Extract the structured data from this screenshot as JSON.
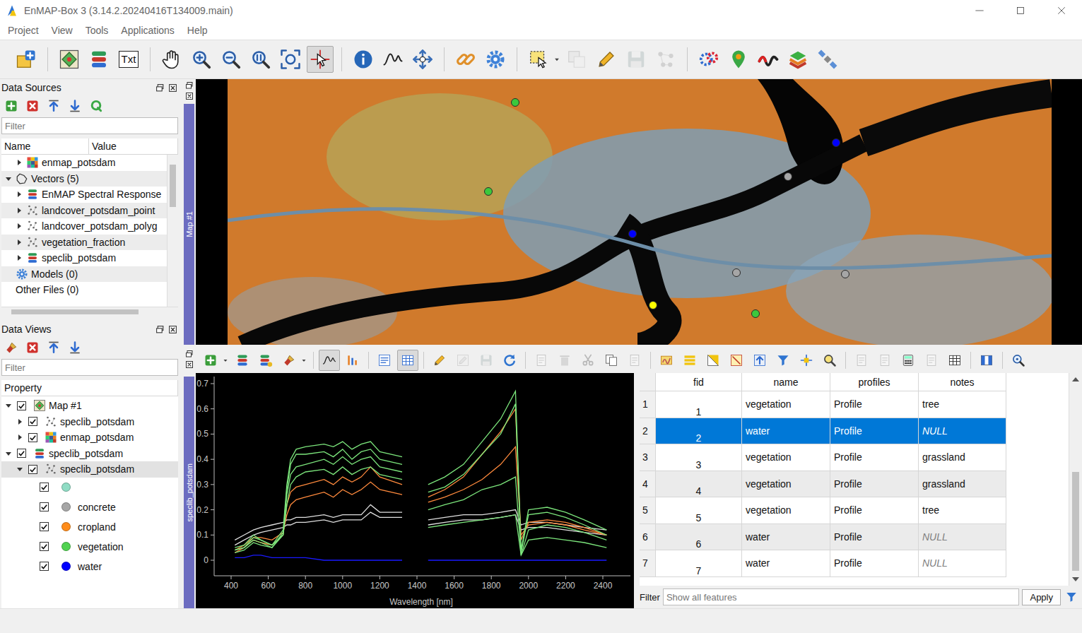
{
  "window": {
    "title": "EnMAP-Box 3 (3.14.2.20240416T134009.main)"
  },
  "menu": [
    {
      "label": "Project"
    },
    {
      "label": "View"
    },
    {
      "label": "Tools"
    },
    {
      "label": "Applications"
    },
    {
      "label": "Help"
    }
  ],
  "toolbar": {
    "txt_label": "Txt",
    "tools": [
      {
        "active": false,
        "disabled": false
      },
      {
        "active": false,
        "disabled": false
      },
      {
        "active": false,
        "disabled": false
      },
      {
        "active": false,
        "disabled": false
      },
      {
        "active": false,
        "disabled": false
      },
      {
        "active": false,
        "disabled": false
      },
      {
        "active": false,
        "disabled": false
      },
      {
        "active": false,
        "disabled": false
      },
      {
        "active": false,
        "disabled": false
      },
      {
        "active": true,
        "disabled": false
      },
      {
        "active": false,
        "disabled": false
      },
      {
        "active": false,
        "disabled": false
      },
      {
        "active": false,
        "disabled": false
      },
      {
        "active": false,
        "disabled": false
      },
      {
        "active": false,
        "disabled": false
      },
      {
        "active": false,
        "disabled": false
      },
      {
        "active": false,
        "disabled": true
      },
      {
        "active": false,
        "disabled": false
      },
      {
        "active": false,
        "disabled": true
      },
      {
        "active": false,
        "disabled": true
      },
      {
        "active": false,
        "disabled": false
      },
      {
        "active": false,
        "disabled": false
      },
      {
        "active": false,
        "disabled": false
      },
      {
        "active": false,
        "disabled": false
      },
      {
        "active": false,
        "disabled": false
      }
    ]
  },
  "data_sources": {
    "title": "Data Sources",
    "filter_placeholder": "Filter",
    "columns": [
      "Name",
      "Value"
    ],
    "items": [
      {
        "label": "enmap_potsdam",
        "level": 1,
        "kind": "raster",
        "expandable": true,
        "expanded": false
      },
      {
        "label": "Vectors (5)",
        "level": 0,
        "kind": "vectors",
        "expandable": true,
        "expanded": true
      },
      {
        "label": "EnMAP Spectral Response",
        "level": 1,
        "kind": "spectral-library",
        "expandable": true,
        "expanded": false
      },
      {
        "label": "landcover_potsdam_point",
        "level": 1,
        "kind": "points",
        "expandable": true,
        "expanded": false
      },
      {
        "label": "landcover_potsdam_polyg",
        "level": 1,
        "kind": "points",
        "expandable": true,
        "expanded": false
      },
      {
        "label": "vegetation_fraction",
        "level": 1,
        "kind": "points",
        "expandable": true,
        "expanded": false
      },
      {
        "label": "speclib_potsdam",
        "level": 1,
        "kind": "spectral-library",
        "expandable": true,
        "expanded": false
      },
      {
        "label": "Models (0)",
        "level": 0,
        "kind": "gear",
        "expandable": false,
        "expanded": false
      },
      {
        "label": "Other Files (0)",
        "level": 0,
        "kind": "none",
        "expandable": false,
        "expanded": false
      }
    ]
  },
  "data_views": {
    "title": "Data Views",
    "filter_placeholder": "Filter",
    "columns": [
      "Property"
    ],
    "items": [
      {
        "label": "Map #1",
        "level": 0,
        "kind": "map-view",
        "expandable": true,
        "expanded": true,
        "checked": true,
        "selected": false
      },
      {
        "label": "speclib_potsdam",
        "level": 1,
        "kind": "points",
        "expandable": true,
        "expanded": false,
        "checked": true,
        "selected": false
      },
      {
        "label": "enmap_potsdam",
        "level": 1,
        "kind": "raster",
        "expandable": true,
        "expanded": false,
        "checked": true,
        "selected": false
      },
      {
        "label": "speclib_potsdam",
        "level": 0,
        "kind": "spectral-library",
        "expandable": true,
        "expanded": true,
        "checked": true,
        "selected": false
      },
      {
        "label": "speclib_potsdam",
        "level": 1,
        "kind": "points",
        "expandable": true,
        "expanded": true,
        "checked": true,
        "selected": true
      },
      {
        "label": "",
        "level": 2,
        "kind": "legend",
        "color": "#8fdcc4",
        "expandable": false,
        "expanded": false,
        "checked": true,
        "selected": false
      },
      {
        "label": "concrete",
        "level": 2,
        "kind": "legend",
        "color": "#a6a6a6",
        "expandable": false,
        "expanded": false,
        "checked": true,
        "selected": false
      },
      {
        "label": "cropland",
        "level": 2,
        "kind": "legend",
        "color": "#ff8c1a",
        "expandable": false,
        "expanded": false,
        "checked": true,
        "selected": false
      },
      {
        "label": "vegetation",
        "level": 2,
        "kind": "legend",
        "color": "#50d250",
        "expandable": false,
        "expanded": false,
        "checked": true,
        "selected": false
      },
      {
        "label": "water",
        "level": 2,
        "kind": "legend",
        "color": "#0000ff",
        "expandable": false,
        "expanded": false,
        "checked": true,
        "selected": false
      }
    ]
  },
  "map": {
    "label": "Map #1",
    "points": [
      {
        "color": "#3cc83c"
      },
      {
        "color": "#3cc83c"
      },
      {
        "color": "#0000ff"
      },
      {
        "color": "#a6a6a6"
      },
      {
        "color": "#0000ff"
      },
      {
        "color": "#a6a6a6"
      },
      {
        "color": "#a6a6a6"
      },
      {
        "color": "#ffff00"
      },
      {
        "color": "#3cc83c"
      }
    ]
  },
  "speclib": {
    "dock_label": "speclib_potsdam",
    "tools": [
      {
        "active": false,
        "disabled": false
      },
      {
        "active": false,
        "disabled": false
      },
      {
        "active": false,
        "disabled": false
      },
      {
        "active": false,
        "disabled": false
      },
      {
        "active": true,
        "disabled": false
      },
      {
        "active": false,
        "disabled": false
      },
      {
        "active": false,
        "disabled": false
      },
      {
        "active": true,
        "disabled": false
      },
      {
        "active": false,
        "disabled": false
      },
      {
        "active": false,
        "disabled": true
      },
      {
        "active": false,
        "disabled": true
      },
      {
        "active": false,
        "disabled": false
      },
      {
        "active": false,
        "disabled": true
      },
      {
        "active": false,
        "disabled": true
      },
      {
        "active": false,
        "disabled": true
      },
      {
        "active": false,
        "disabled": false
      },
      {
        "active": false,
        "disabled": true
      },
      {
        "active": false,
        "disabled": false
      },
      {
        "active": false,
        "disabled": false
      },
      {
        "active": false,
        "disabled": false
      },
      {
        "active": false,
        "disabled": false
      },
      {
        "active": false,
        "disabled": false
      },
      {
        "active": false,
        "disabled": false
      },
      {
        "active": false,
        "disabled": false
      },
      {
        "active": false,
        "disabled": false
      },
      {
        "active": false,
        "disabled": true
      },
      {
        "active": false,
        "disabled": true
      },
      {
        "active": false,
        "disabled": false
      },
      {
        "active": false,
        "disabled": true
      },
      {
        "active": false,
        "disabled": false
      },
      {
        "active": false,
        "disabled": false
      },
      {
        "active": false,
        "disabled": false
      }
    ],
    "chart": {
      "y_ticks": [
        {
          "label": "0.7",
          "value": 0.7
        },
        {
          "label": "0.6",
          "value": 0.6
        },
        {
          "label": "0.5",
          "value": 0.5
        },
        {
          "label": "0.4",
          "value": 0.4
        },
        {
          "label": "0.3",
          "value": 0.3
        },
        {
          "label": "0.2",
          "value": 0.2
        },
        {
          "label": "0.1",
          "value": 0.1
        },
        {
          "label": "0",
          "value": 0
        }
      ],
      "x_ticks": [
        {
          "label": "400",
          "value": 400
        },
        {
          "label": "600",
          "value": 600
        },
        {
          "label": "800",
          "value": 800
        },
        {
          "label": "1000",
          "value": 1000
        },
        {
          "label": "1200",
          "value": 1200
        },
        {
          "label": "1400",
          "value": 1400
        },
        {
          "label": "1600",
          "value": 1600
        },
        {
          "label": "1800",
          "value": 1800
        },
        {
          "label": "2000",
          "value": 2000
        },
        {
          "label": "2200",
          "value": 2200
        },
        {
          "label": "2400",
          "value": 2400
        }
      ],
      "x_label": "Wavelength [nm]",
      "wavelengths": [
        420,
        470,
        520,
        560,
        620,
        680,
        700,
        720,
        750,
        800,
        900,
        950,
        1000,
        1050,
        1100,
        1150,
        1200,
        1320,
        1460,
        1550,
        1650,
        1750,
        1850,
        1930,
        1960,
        2000,
        2100,
        2200,
        2300,
        2420
      ],
      "series": [
        {
          "color": "#e0e0e0",
          "values": [
            0.08,
            0.1,
            0.12,
            0.13,
            0.14,
            0.15,
            0.16,
            0.16,
            0.17,
            0.17,
            0.18,
            0.17,
            0.18,
            0.18,
            0.18,
            0.22,
            0.19,
            0.19,
            0.16,
            0.17,
            0.18,
            0.18,
            0.19,
            0.2,
            0.14,
            0.15,
            0.15,
            0.14,
            0.13,
            0.12
          ]
        },
        {
          "color": "#e0e0e0",
          "values": [
            0.06,
            0.08,
            0.1,
            0.11,
            0.12,
            0.13,
            0.14,
            0.14,
            0.15,
            0.15,
            0.16,
            0.15,
            0.16,
            0.16,
            0.16,
            0.19,
            0.17,
            0.17,
            0.14,
            0.15,
            0.16,
            0.16,
            0.17,
            0.18,
            0.12,
            0.13,
            0.13,
            0.12,
            0.11,
            0.1
          ]
        },
        {
          "color": "#ff8a3d",
          "values": [
            0.03,
            0.05,
            0.08,
            0.07,
            0.06,
            0.1,
            0.22,
            0.27,
            0.29,
            0.3,
            0.32,
            0.3,
            0.33,
            0.31,
            0.33,
            0.37,
            0.33,
            0.3,
            0.25,
            0.28,
            0.33,
            0.42,
            0.51,
            0.6,
            0.08,
            0.15,
            0.16,
            0.15,
            0.13,
            0.1
          ]
        },
        {
          "color": "#ff8a3d",
          "values": [
            0.04,
            0.06,
            0.09,
            0.09,
            0.08,
            0.11,
            0.18,
            0.22,
            0.24,
            0.25,
            0.27,
            0.25,
            0.28,
            0.26,
            0.28,
            0.31,
            0.28,
            0.26,
            0.23,
            0.25,
            0.28,
            0.32,
            0.38,
            0.45,
            0.1,
            0.14,
            0.15,
            0.14,
            0.12,
            0.1
          ]
        },
        {
          "color": "#7ce67c",
          "values": [
            0.04,
            0.05,
            0.09,
            0.08,
            0.06,
            0.12,
            0.3,
            0.4,
            0.44,
            0.45,
            0.46,
            0.45,
            0.47,
            0.44,
            0.46,
            0.47,
            0.43,
            0.41,
            0.3,
            0.33,
            0.38,
            0.47,
            0.56,
            0.67,
            0.04,
            0.2,
            0.21,
            0.19,
            0.16,
            0.12
          ]
        },
        {
          "color": "#7ce67c",
          "values": [
            0.03,
            0.04,
            0.07,
            0.06,
            0.05,
            0.1,
            0.28,
            0.38,
            0.42,
            0.42,
            0.43,
            0.41,
            0.44,
            0.4,
            0.43,
            0.44,
            0.4,
            0.38,
            0.27,
            0.29,
            0.34,
            0.42,
            0.5,
            0.62,
            0.03,
            0.18,
            0.19,
            0.17,
            0.14,
            0.1
          ]
        },
        {
          "color": "#7ce67c",
          "values": [
            0.04,
            0.05,
            0.08,
            0.07,
            0.05,
            0.11,
            0.26,
            0.34,
            0.37,
            0.38,
            0.4,
            0.38,
            0.41,
            0.38,
            0.4,
            0.41,
            0.37,
            0.35,
            0.2,
            0.22,
            0.24,
            0.28,
            0.3,
            0.33,
            0.02,
            0.12,
            0.14,
            0.13,
            0.11,
            0.08
          ]
        },
        {
          "color": "#7ce67c",
          "values": [
            0.05,
            0.06,
            0.1,
            0.08,
            0.06,
            0.1,
            0.22,
            0.3,
            0.33,
            0.35,
            0.36,
            0.34,
            0.37,
            0.34,
            0.36,
            0.37,
            0.34,
            0.32,
            0.13,
            0.14,
            0.15,
            0.16,
            0.17,
            0.18,
            0.02,
            0.08,
            0.09,
            0.08,
            0.07,
            0.05
          ]
        },
        {
          "color": "#1a1aff",
          "values": [
            0.01,
            0.01,
            0.02,
            0.02,
            0.01,
            0.01,
            0.01,
            0.01,
            0.01,
            0.01,
            0,
            0,
            0,
            0,
            0,
            0,
            0,
            0,
            0,
            0,
            0,
            0,
            0,
            0,
            0,
            0,
            0,
            0,
            0,
            0
          ]
        }
      ]
    },
    "table": {
      "columns": [
        "fid",
        "name",
        "profiles",
        "notes"
      ],
      "rows": [
        {
          "num": "1",
          "fid": "1",
          "name": "vegetation",
          "profiles": "Profile",
          "notes": "tree",
          "notes_null": false,
          "selected": false
        },
        {
          "num": "2",
          "fid": "2",
          "name": "water",
          "profiles": "Profile",
          "notes": "NULL",
          "notes_null": true,
          "selected": true
        },
        {
          "num": "3",
          "fid": "3",
          "name": "vegetation",
          "profiles": "Profile",
          "notes": "grassland",
          "notes_null": false,
          "selected": false
        },
        {
          "num": "4",
          "fid": "4",
          "name": "vegetation",
          "profiles": "Profile",
          "notes": "grassland",
          "notes_null": false,
          "selected": false
        },
        {
          "num": "5",
          "fid": "5",
          "name": "vegetation",
          "profiles": "Profile",
          "notes": "tree",
          "notes_null": false,
          "selected": false
        },
        {
          "num": "6",
          "fid": "6",
          "name": "water",
          "profiles": "Profile",
          "notes": "NULL",
          "notes_null": true,
          "selected": false
        },
        {
          "num": "7",
          "fid": "7",
          "name": "water",
          "profiles": "Profile",
          "notes": "NULL",
          "notes_null": true,
          "selected": false
        }
      ]
    },
    "filter": {
      "label": "Filter",
      "placeholder": "Show all features",
      "button": "Apply"
    }
  }
}
